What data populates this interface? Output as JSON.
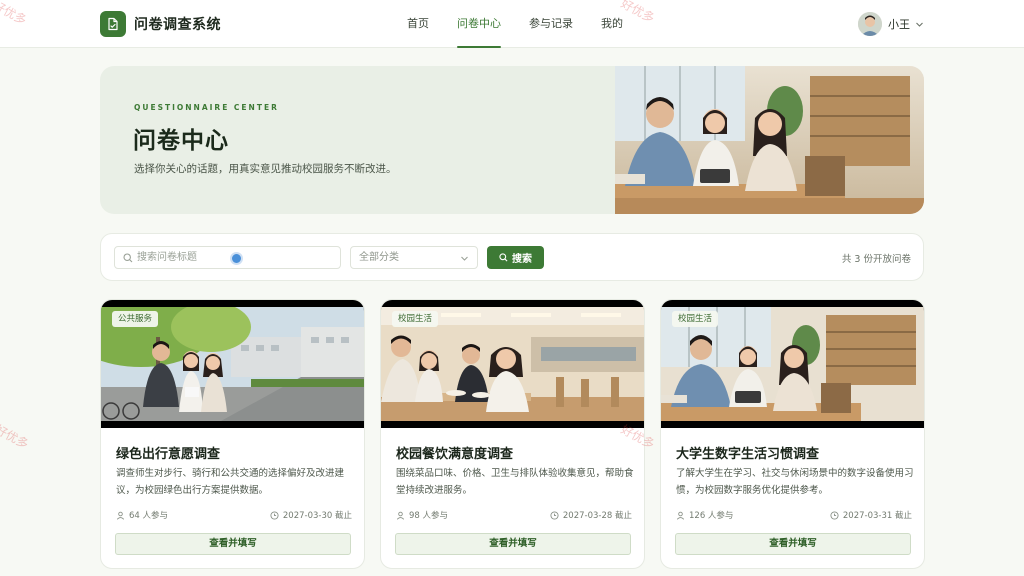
{
  "app": {
    "title": "问卷调查系统"
  },
  "nav": {
    "items": [
      {
        "label": "首页",
        "active": false
      },
      {
        "label": "问卷中心",
        "active": true
      },
      {
        "label": "参与记录",
        "active": false
      },
      {
        "label": "我的",
        "active": false
      }
    ]
  },
  "user": {
    "name": "小王",
    "menu_icon": "chevron-down-icon"
  },
  "hero": {
    "eyebrow": "QUESTIONNAIRE CENTER",
    "title": "问卷中心",
    "description": "选择你关心的话题，用真实意见推动校园服务不断改进。"
  },
  "filter": {
    "search_placeholder": "搜索问卷标题",
    "search_value": "",
    "category_selected": "全部分类",
    "search_button": "搜索",
    "count_text": "共 3 份开放问卷"
  },
  "cards": [
    {
      "tag": "公共服务",
      "title": "绿色出行意愿调查",
      "description": "调查师生对步行、骑行和公共交通的选择偏好及改进建议，为校园绿色出行方案提供数据。",
      "participants": "64 人参与",
      "deadline": "2027-03-30 截止",
      "button": "查看并填写"
    },
    {
      "tag": "校园生活",
      "title": "校园餐饮满意度调查",
      "description": "围绕菜品口味、价格、卫生与排队体验收集意见，帮助食堂持续改进服务。",
      "participants": "98 人参与",
      "deadline": "2027-03-28 截止",
      "button": "查看并填写"
    },
    {
      "tag": "校园生活",
      "title": "大学生数字生活习惯调查",
      "description": "了解大学生在学习、社交与休闲场景中的数字设备使用习惯，为校园数字服务优化提供参考。",
      "participants": "126 人参与",
      "deadline": "2027-03-31 截止",
      "button": "查看并填写"
    }
  ],
  "watermark": "好优多",
  "colors": {
    "accent": "#3d7a35",
    "hero_bg": "#e9efe6",
    "page_bg": "#f7f9f4"
  }
}
